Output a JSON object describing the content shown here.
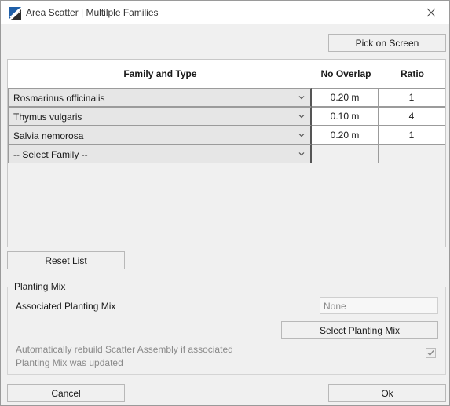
{
  "window": {
    "title": "Area Scatter | Multilple Families",
    "colors": {
      "accent_blue": "#1f5fa8",
      "grid_border_dark": "#555555"
    }
  },
  "toolbar": {
    "pick_on_screen": "Pick on Screen"
  },
  "table": {
    "headers": [
      "Family and Type",
      "No Overlap",
      "Ratio"
    ],
    "rows": [
      {
        "family": "Rosmarinus officinalis",
        "overlap": "0.20 m",
        "ratio": "1"
      },
      {
        "family": "Thymus vulgaris",
        "overlap": "0.10 m",
        "ratio": "4"
      },
      {
        "family": "Salvia nemorosa",
        "overlap": "0.20 m",
        "ratio": "1"
      },
      {
        "family": "-- Select Family --",
        "overlap": "",
        "ratio": ""
      }
    ]
  },
  "reset_list": "Reset List",
  "planting_mix": {
    "group_label": "Planting Mix",
    "associated_label": "Associated Planting Mix",
    "associated_value": "None",
    "select_button": "Select Planting Mix",
    "auto_rebuild_line1": "Automatically rebuild Scatter Assembly if associated",
    "auto_rebuild_line2": "Planting Mix was updated",
    "auto_rebuild_checked": true
  },
  "footer": {
    "cancel": "Cancel",
    "ok": "Ok"
  }
}
